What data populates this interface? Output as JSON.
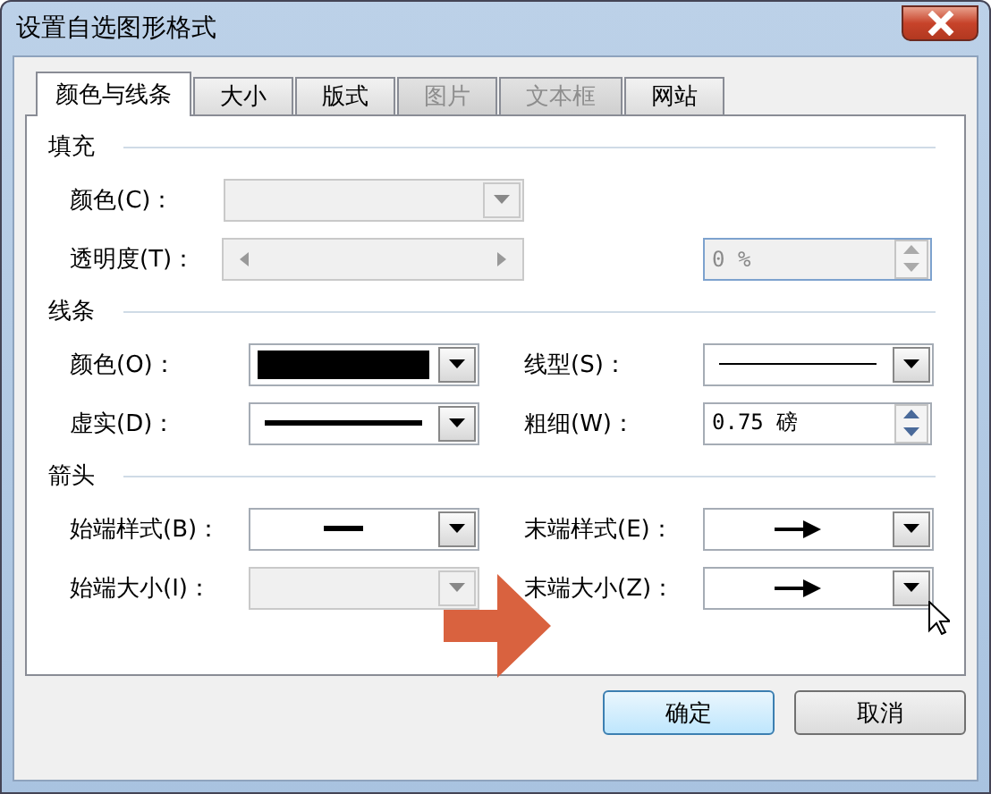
{
  "window": {
    "title": "设置自选图形格式"
  },
  "tabs": [
    {
      "label": "颜色与线条",
      "selected": true,
      "disabled": false
    },
    {
      "label": "大小",
      "selected": false,
      "disabled": false
    },
    {
      "label": "版式",
      "selected": false,
      "disabled": false
    },
    {
      "label": "图片",
      "selected": false,
      "disabled": true
    },
    {
      "label": "文本框",
      "selected": false,
      "disabled": true
    },
    {
      "label": "网站",
      "selected": false,
      "disabled": false
    }
  ],
  "sections": [
    {
      "heading": "填充",
      "rows": [
        {
          "left": {
            "label": "颜色(C)：",
            "control": {
              "kind": "empty",
              "wide": true,
              "disabled": true
            }
          }
        },
        {
          "left": {
            "label": "透明度(T)：",
            "control": {
              "kind": "slider",
              "wide": true,
              "disabled": true
            }
          },
          "right": {
            "control": {
              "kind": "spin",
              "value": "0 %",
              "disabled": true,
              "focused": true
            }
          }
        }
      ]
    },
    {
      "heading": "线条",
      "rows": [
        {
          "left": {
            "label": "颜色(O)：",
            "control": {
              "kind": "swatch",
              "wide": false,
              "disabled": false
            }
          },
          "right": {
            "label": "线型(S)：",
            "control": {
              "kind": "thin-line",
              "wide": false,
              "disabled": false
            }
          }
        },
        {
          "left": {
            "label": "虚实(D)：",
            "control": {
              "kind": "thick-line",
              "wide": false,
              "disabled": false
            }
          },
          "right": {
            "label": "粗细(W)：",
            "control": {
              "kind": "spin",
              "value": "0.75 磅",
              "disabled": false,
              "focused": false
            }
          }
        }
      ]
    },
    {
      "heading": "箭头",
      "rows": [
        {
          "left": {
            "label": "始端样式(B)：",
            "control": {
              "kind": "short-line",
              "wide": false,
              "disabled": false
            }
          },
          "right": {
            "label": "末端样式(E)：",
            "control": {
              "kind": "arrow",
              "wide": false,
              "disabled": false
            }
          }
        },
        {
          "left": {
            "label": "始端大小(I)：",
            "control": {
              "kind": "empty",
              "wide": false,
              "disabled": true
            }
          },
          "right": {
            "label": "末端大小(Z)：",
            "control": {
              "kind": "arrow",
              "wide": false,
              "disabled": false
            }
          }
        }
      ]
    }
  ],
  "buttons": [
    {
      "label": "确定",
      "default": true
    },
    {
      "label": "取消",
      "default": false
    }
  ]
}
